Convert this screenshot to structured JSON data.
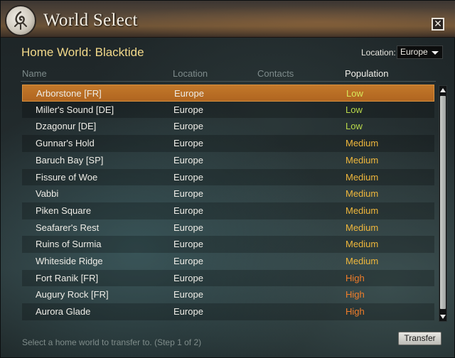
{
  "window": {
    "title": "World Select"
  },
  "home_world": {
    "label": "Home World: Blacktide"
  },
  "location": {
    "label": "Location:",
    "selected": "Europe"
  },
  "columns": {
    "name": "Name",
    "location": "Location",
    "contacts": "Contacts",
    "population": "Population"
  },
  "worlds": [
    {
      "name": "Arborstone [FR]",
      "location": "Europe",
      "population": "Low"
    },
    {
      "name": "Miller's Sound [DE]",
      "location": "Europe",
      "population": "Low"
    },
    {
      "name": "Dzagonur [DE]",
      "location": "Europe",
      "population": "Low"
    },
    {
      "name": "Gunnar's Hold",
      "location": "Europe",
      "population": "Medium"
    },
    {
      "name": "Baruch Bay [SP]",
      "location": "Europe",
      "population": "Medium"
    },
    {
      "name": "Fissure of Woe",
      "location": "Europe",
      "population": "Medium"
    },
    {
      "name": "Vabbi",
      "location": "Europe",
      "population": "Medium"
    },
    {
      "name": "Piken Square",
      "location": "Europe",
      "population": "Medium"
    },
    {
      "name": "Seafarer's Rest",
      "location": "Europe",
      "population": "Medium"
    },
    {
      "name": "Ruins of Surmia",
      "location": "Europe",
      "population": "Medium"
    },
    {
      "name": "Whiteside Ridge",
      "location": "Europe",
      "population": "Medium"
    },
    {
      "name": "Fort Ranik [FR]",
      "location": "Europe",
      "population": "High"
    },
    {
      "name": "Augury Rock [FR]",
      "location": "Europe",
      "population": "High"
    },
    {
      "name": "Aurora Glade",
      "location": "Europe",
      "population": "High"
    }
  ],
  "selected_index": 0,
  "population_colors": {
    "Low": "#b9d84a",
    "Medium": "#efb73c",
    "High": "#f07d2a"
  },
  "footer": {
    "hint": "Select a home world to transfer to. (Step 1 of 2)",
    "transfer_label": "Transfer"
  },
  "icons": {
    "logo": "game-logo-icon",
    "close": "close-icon",
    "dropdown": "chevron-down-icon"
  }
}
